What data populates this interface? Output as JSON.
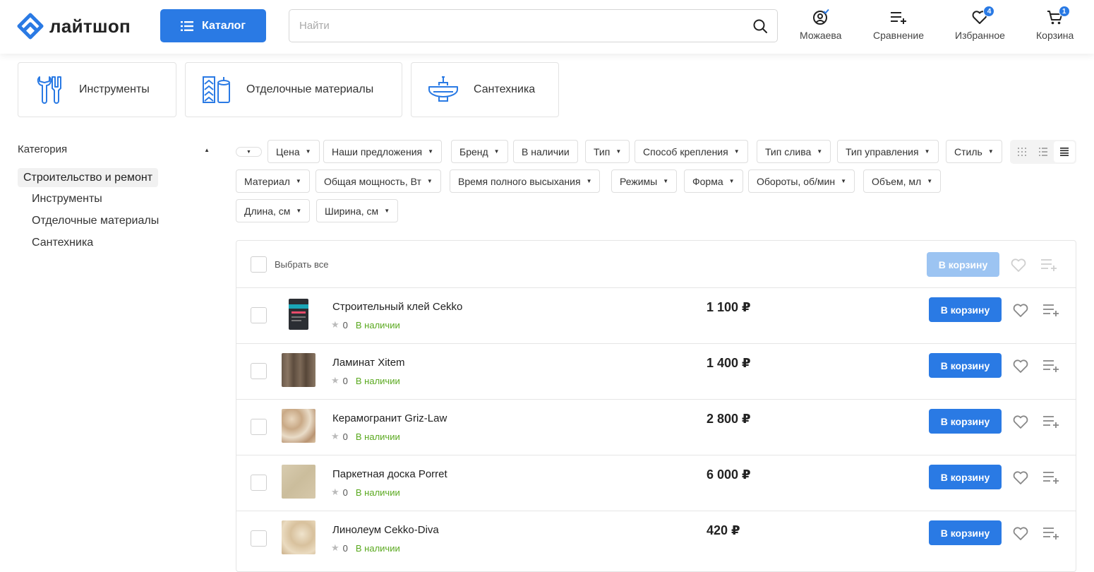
{
  "header": {
    "logo_text": "лайтшоп",
    "catalog_label": "Каталог",
    "search_placeholder": "Найти",
    "user_label": "Можаева",
    "compare_label": "Сравнение",
    "favorites_label": "Избранное",
    "favorites_count": "4",
    "cart_label": "Корзина",
    "cart_count": "1"
  },
  "categories": [
    {
      "label": "Инструменты",
      "icon": "tools-icon"
    },
    {
      "label": "Отделочные материалы",
      "icon": "finishing-materials-icon"
    },
    {
      "label": "Сантехника",
      "icon": "sink-icon"
    }
  ],
  "sidebar": {
    "title": "Категория",
    "active": "Строительство и ремонт",
    "items": [
      "Инструменты",
      "Отделочные материалы",
      "Сантехника"
    ]
  },
  "filters": {
    "row1": [
      "Цена",
      "Наши предложения",
      "Бренд",
      "В наличии",
      "Тип",
      "Способ крепления",
      "Тип слива",
      "Тип управления",
      "Стиль"
    ],
    "row2": [
      "Материал",
      "Общая мощность, Вт",
      "Время полного высыхания",
      "Режимы",
      "Форма",
      "Обороты, об/мин",
      "Объем, мл"
    ],
    "row3": [
      "Длина, см",
      "Ширина, см"
    ]
  },
  "table": {
    "select_all": "Выбрать все",
    "bulk_cart": "В корзину",
    "products": [
      {
        "name": "Строительный клей Cekko",
        "rating": "0",
        "stock": "В наличии",
        "price": "1 100 ₽",
        "button": "В корзину"
      },
      {
        "name": "Ламинат Xitem",
        "rating": "0",
        "stock": "В наличии",
        "price": "1 400 ₽",
        "button": "В корзину"
      },
      {
        "name": "Керамогранит Griz-Law",
        "rating": "0",
        "stock": "В наличии",
        "price": "2 800 ₽",
        "button": "В корзину"
      },
      {
        "name": "Паркетная доска Porret",
        "rating": "0",
        "stock": "В наличии",
        "price": "6 000 ₽",
        "button": "В корзину"
      },
      {
        "name": "Линолеум Cekko-Diva",
        "rating": "0",
        "stock": "В наличии",
        "price": "420 ₽",
        "button": "В корзину"
      }
    ]
  },
  "colors": {
    "accent": "#2a7ae4",
    "accent_disabled": "#9cc4f2",
    "in_stock": "#5aa91f"
  }
}
